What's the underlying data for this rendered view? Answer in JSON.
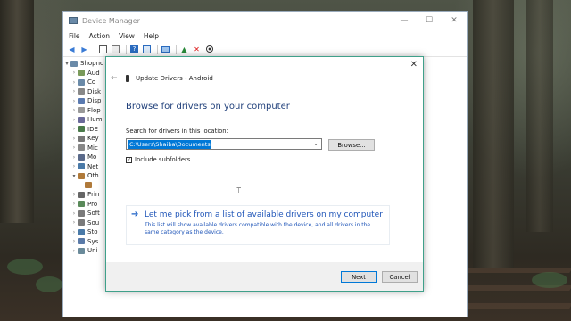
{
  "device_manager": {
    "title": "Device Manager",
    "window_controls": {
      "minimize": "—",
      "maximize": "☐",
      "close": "✕"
    },
    "menu": [
      "File",
      "Action",
      "View",
      "Help"
    ],
    "tree": {
      "root": "Shopno",
      "items": [
        "Aud",
        "Co",
        "Disk",
        "Disp",
        "Flop",
        "Hum",
        "IDE",
        "Key",
        "Mic",
        "Mo",
        "Net",
        "Oth",
        "",
        "Prin",
        "Pro",
        "Soft",
        "Sou",
        "Sto",
        "Sys",
        "Uni"
      ]
    }
  },
  "dialog": {
    "close_glyph": "✕",
    "back_glyph": "←",
    "title": "Update Drivers - Android",
    "heading": "Browse for drivers on your computer",
    "search_label": "Search for drivers in this location:",
    "path_value": "C:\\Users\\Shaiba\\Documents",
    "browse_label": "Browse...",
    "include_subfolders_label": "Include subfolders",
    "include_subfolders_checked": true,
    "pick_title": "Let me pick from a list of available drivers on my computer",
    "pick_description": "This list will show available drivers compatible with the device, and all drivers in the same category as the device.",
    "next_label": "Next",
    "cancel_label": "Cancel"
  },
  "colors": {
    "accent": "#0078d7",
    "heading": "#1f3f7a",
    "link": "#1f55b8",
    "dialog_border": "#3fa08a"
  }
}
